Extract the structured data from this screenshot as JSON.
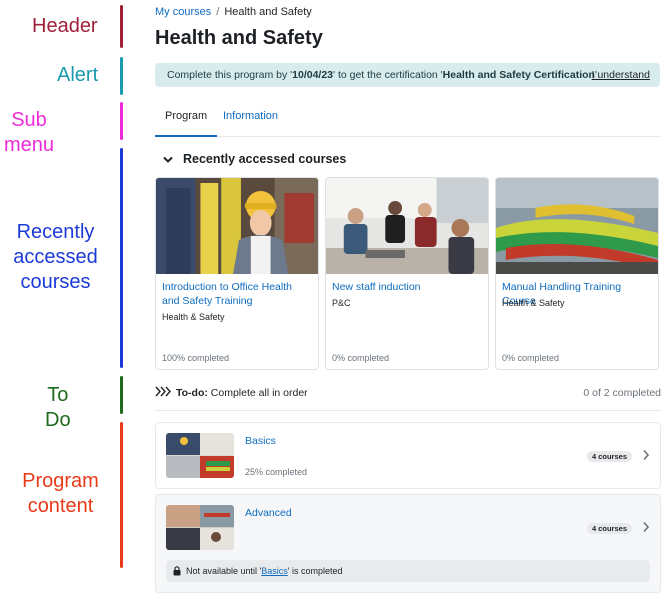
{
  "annotations": {
    "header": "Header",
    "alert": "Alert",
    "sub_menu": "Sub menu",
    "recently_accessed": "Recently accessed courses",
    "todo": "To Do",
    "program_content": "Program content"
  },
  "breadcrumb": {
    "parent": "My courses",
    "separator": "/",
    "current": "Health and Safety"
  },
  "page_title": "Health and Safety",
  "alert": {
    "prefix": "Complete this program by '",
    "date": "10/04/23",
    "middle": "' to get the certification '",
    "certification": "Health and Safety Certification",
    "suffix": "'",
    "action": "I understand"
  },
  "tabs": [
    {
      "label": "Program",
      "active": true
    },
    {
      "label": "Information",
      "active": false
    }
  ],
  "recent": {
    "heading": "Recently accessed courses",
    "courses": [
      {
        "title": "Introduction to Office Health and Safety Training",
        "category": "Health & Safety",
        "progress": "100% completed"
      },
      {
        "title": "New staff induction",
        "category": "P&C",
        "progress": "0% completed"
      },
      {
        "title": "Manual Handling Training Course",
        "category": "Health & Safety",
        "progress": "0% completed"
      }
    ]
  },
  "todo": {
    "label": "To-do:",
    "text": " Complete all in order",
    "count": "0 of 2 completed"
  },
  "programs": [
    {
      "name": "Basics",
      "status": "25% completed",
      "badge": "4 courses"
    },
    {
      "name": "Advanced",
      "badge": "4 courses",
      "lock": {
        "prefix": "Not available until '",
        "link": "Basics",
        "suffix": "' is completed"
      }
    }
  ],
  "colors": {
    "link": "#0f6cbf",
    "alert_bg": "#d8ecee",
    "header": "#a0203a",
    "alert": "#1a9aae",
    "sub_menu": "#ee2bd8",
    "recent": "#1c3ad6",
    "todo": "#1e6a1e",
    "program": "#e83a18"
  }
}
